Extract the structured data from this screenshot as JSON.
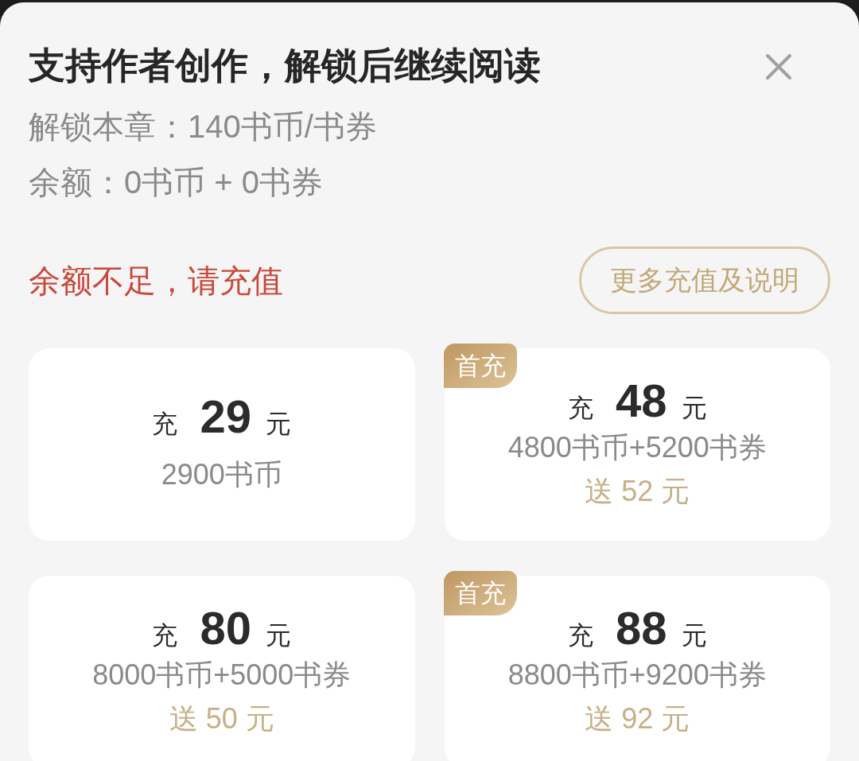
{
  "sheet": {
    "title": "支持作者创作，解锁后继续阅读",
    "unlock_cost": "解锁本章：140书币/书券",
    "balance": "余额：0书币 + 0书券"
  },
  "notice": "余额不足，请充值",
  "more_button": "更多充值及说明",
  "packages": [
    {
      "prefix": "充",
      "amount": "29",
      "unit": "元",
      "content": "2900书币"
    },
    {
      "badge": "首充",
      "prefix": "充",
      "amount": "48",
      "unit": "元",
      "content": "4800书币+5200书券",
      "bonus": "送 52 元"
    },
    {
      "prefix": "充",
      "amount": "80",
      "unit": "元",
      "content": "8000书币+5000书券",
      "bonus": "送 50 元"
    },
    {
      "badge": "首充",
      "prefix": "充",
      "amount": "88",
      "unit": "元",
      "content": "8800书币+9200书券",
      "bonus": "送 92 元"
    }
  ]
}
